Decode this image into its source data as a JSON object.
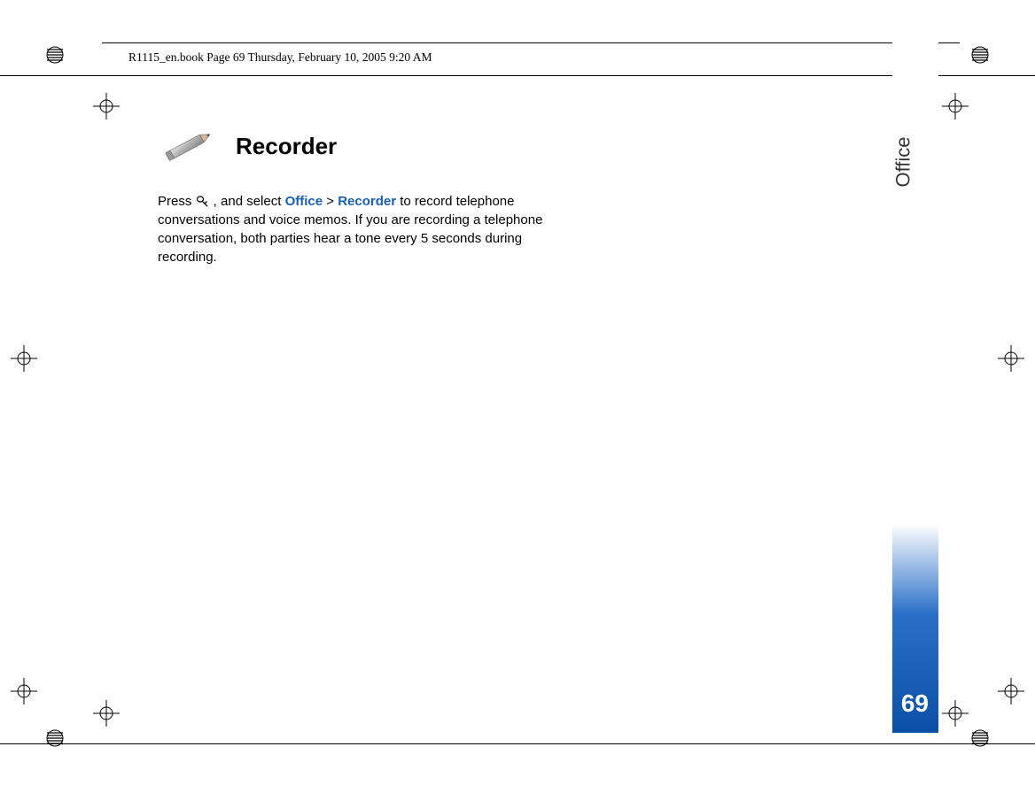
{
  "header": {
    "text": "R1115_en.book  Page 69  Thursday, February 10, 2005  9:20 AM"
  },
  "sideTab": {
    "label": "Office",
    "pageNumber": "69"
  },
  "content": {
    "heading": "Recorder",
    "body": {
      "part1": "Press ",
      "part2": " , and select ",
      "link1": "Office",
      "gt": " > ",
      "link2": "Recorder",
      "part3": " to record telephone conversations and voice memos. If you are recording a telephone conversation, both parties hear a tone every 5 seconds during recording."
    }
  }
}
